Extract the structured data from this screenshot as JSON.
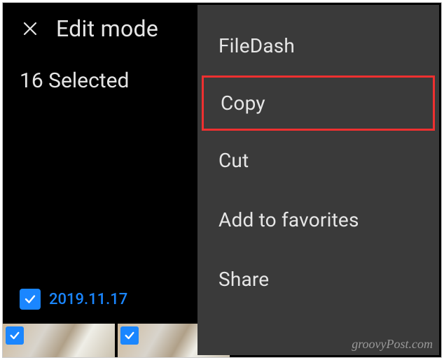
{
  "header": {
    "title": "Edit mode"
  },
  "selection": {
    "label": "16 Selected"
  },
  "date_group": {
    "checked": true,
    "label": "2019.11.17"
  },
  "menu": {
    "items": [
      {
        "label": "FileDash",
        "highlight": false
      },
      {
        "label": "Copy",
        "highlight": true
      },
      {
        "label": "Cut",
        "highlight": false
      },
      {
        "label": "Add to favorites",
        "highlight": false
      },
      {
        "label": "Share",
        "highlight": false
      }
    ]
  },
  "watermark": "groovyPost.com"
}
